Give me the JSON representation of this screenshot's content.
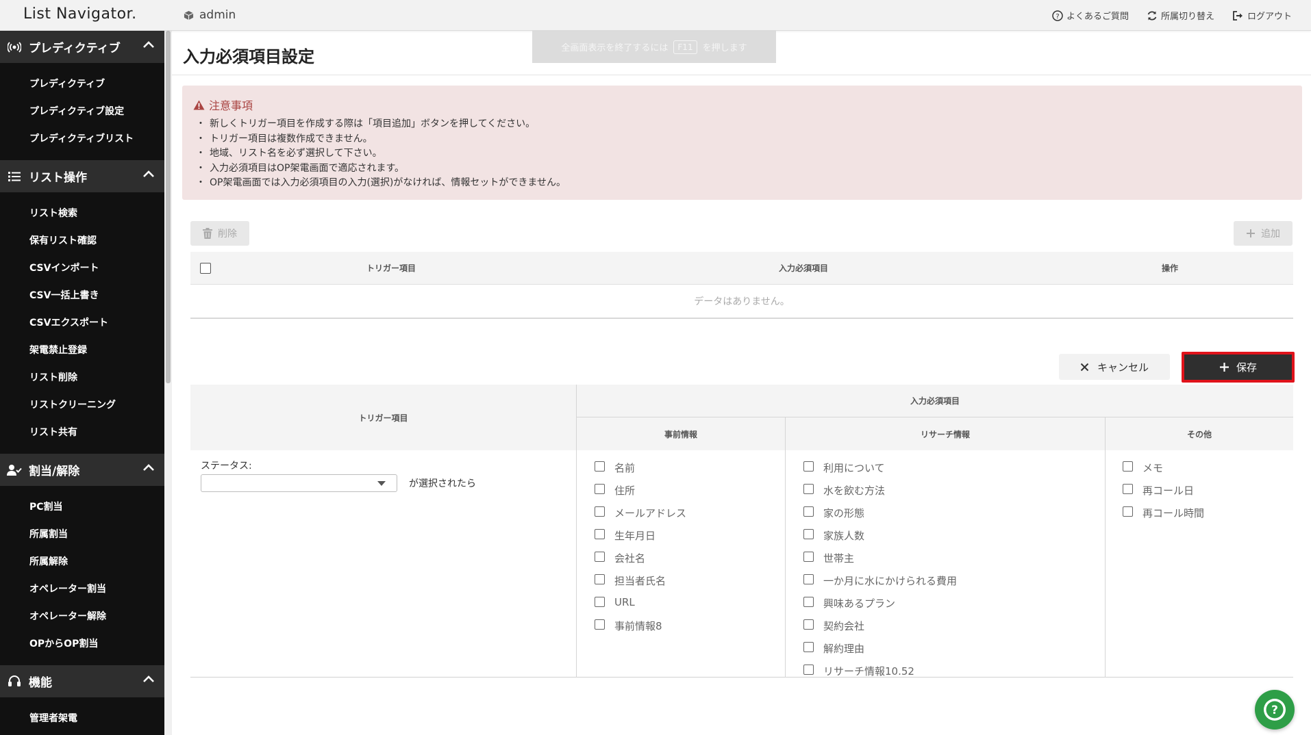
{
  "topbar": {
    "brand": "List Navigator.",
    "user": "admin",
    "links": [
      {
        "label": "よくあるご質問",
        "icon": "question-circle-icon"
      },
      {
        "label": "所属切り替え",
        "icon": "refresh-icon"
      },
      {
        "label": "ログアウト",
        "icon": "logout-icon"
      }
    ]
  },
  "fullscreen_hint": {
    "before": "全画面表示を終了するには",
    "key": "F11",
    "after": "を押します"
  },
  "sidebar": {
    "sections": [
      {
        "title": "プレディクティブ",
        "icon": "broadcast-icon",
        "items": [
          "プレディクティブ",
          "プレディクティブ設定",
          "プレディクティブリスト"
        ]
      },
      {
        "title": "リスト操作",
        "icon": "list-icon",
        "items": [
          "リスト検索",
          "保有リスト確認",
          "CSVインポート",
          "CSV一括上書き",
          "CSVエクスポート",
          "架電禁止登録",
          "リスト削除",
          "リストクリーニング",
          "リスト共有"
        ]
      },
      {
        "title": "割当/解除",
        "icon": "user-check-icon",
        "items": [
          "PC割当",
          "所属割当",
          "所属解除",
          "オペレーター割当",
          "オペレーター解除",
          "OPからOP割当"
        ]
      },
      {
        "title": "機能",
        "icon": "headset-icon",
        "items": [
          "管理者架電"
        ]
      }
    ]
  },
  "main": {
    "title": "入力必須項目設定",
    "alert": {
      "title": "注意事項",
      "lines": [
        "新しくトリガー項目を作成する際は「項目追加」ボタンを押してください。",
        "トリガー項目は複数作成できません。",
        "地域、リスト名を必ず選択して下さい。",
        "入力必須項目はOP架電画面で適応されます。",
        "OP架電画面では入力必須項目の入力(選択)がなければ、情報セットができません。"
      ]
    },
    "delete_label": "削除",
    "add_label": "追加",
    "table1": {
      "headers": [
        "トリガー項目",
        "入力必須項目",
        "操作"
      ],
      "empty": "データはありません。"
    },
    "cancel_label": "キャンセル",
    "save_label": "保存",
    "table2": {
      "trigger_header": "トリガー項目",
      "required_header": "入力必須項目",
      "sub_headers": [
        "事前情報",
        "リサーチ情報",
        "その他"
      ],
      "status_label": "ステータス:",
      "status_value": "",
      "status_suffix": "が選択されたら",
      "pre_info": [
        "名前",
        "住所",
        "メールアドレス",
        "生年月日",
        "会社名",
        "担当者氏名",
        "URL",
        "事前情報8"
      ],
      "research_info": [
        "利用について",
        "水を飲む方法",
        "家の形態",
        "家族人数",
        "世帯主",
        "一か月に水にかけられる費用",
        "興味あるプラン",
        "契約会社",
        "解約理由",
        "リサーチ情報10.52"
      ],
      "other": [
        "メモ",
        "再コール日",
        "再コール時間"
      ]
    }
  },
  "colors": {
    "sidebar_bg": "#111111",
    "sidebar_head": "#2e2e2e",
    "save_highlight": "#e0131b",
    "help": "#2e9e47",
    "alert_bg": "#f2e3e3",
    "alert_title": "#a94442"
  }
}
